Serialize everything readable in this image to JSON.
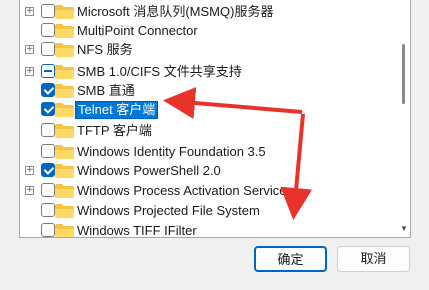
{
  "features": [
    {
      "label": "Microsoft 消息队列(MSMQ)服务器",
      "expander": "+",
      "check": "none"
    },
    {
      "label": "MultiPoint Connector",
      "expander": "",
      "check": "none"
    },
    {
      "label": "NFS 服务",
      "expander": "+",
      "check": "none"
    },
    {
      "label": "SMB 1.0/CIFS 文件共享支持",
      "expander": "+",
      "check": "partial"
    },
    {
      "label": "SMB 直通",
      "expander": "",
      "check": "checked"
    },
    {
      "label": "Telnet 客户端",
      "expander": "",
      "check": "checked",
      "selected": true
    },
    {
      "label": "TFTP 客户端",
      "expander": "",
      "check": "none"
    },
    {
      "label": "Windows Identity Foundation 3.5",
      "expander": "",
      "check": "none"
    },
    {
      "label": "Windows PowerShell 2.0",
      "expander": "+",
      "check": "checked"
    },
    {
      "label": "Windows Process Activation Service",
      "expander": "+",
      "check": "none"
    },
    {
      "label": "Windows Projected File System",
      "expander": "",
      "check": "none"
    },
    {
      "label": "Windows TIFF IFilter",
      "expander": "",
      "check": "none"
    }
  ],
  "buttons": {
    "ok": "确定",
    "cancel": "取消"
  },
  "colors": {
    "accent": "#0067c0",
    "annotation": "#e8322a",
    "folder": "#f6c343"
  }
}
